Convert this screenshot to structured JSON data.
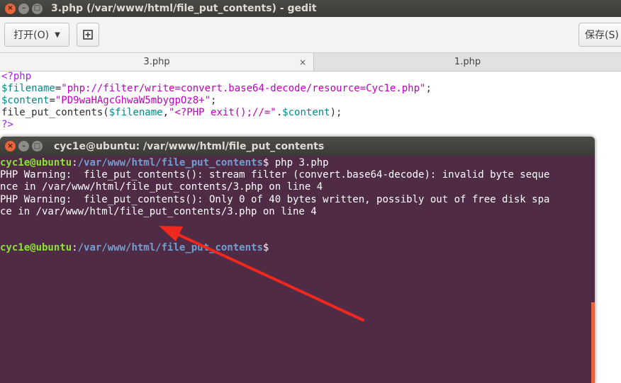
{
  "gedit": {
    "title": "3.php (/var/www/html/file_put_contents) - gedit",
    "toolbar": {
      "open_label": "打开(O)",
      "new_tab_icon": "new-document-icon",
      "save_label": "保存(S)"
    },
    "tabs": [
      {
        "label": "3.php",
        "active": true,
        "close": "×"
      },
      {
        "label": "1.php",
        "active": false
      }
    ],
    "code": {
      "line1": "<?php",
      "line2_var": "$filename",
      "line2_eq": "=",
      "line2_str": "\"php://filter/write=convert.base64-decode/resource=Cyc1e.php\"",
      "line2_end": ";",
      "line3_var": "$content",
      "line3_eq": "=",
      "line3_str": "\"PD9waHAgcGhwaW5mbygpOz8+\"",
      "line3_end": ";",
      "line4_fn": "file_put_contents(",
      "line4_var1": "$filename",
      "line4_comma": ",",
      "line4_str": "\"<?PHP exit();//=\"",
      "line4_dot": ".",
      "line4_var2": "$content",
      "line4_end": ");",
      "line5": "?>"
    }
  },
  "terminal": {
    "title": "cyc1e@ubuntu: /var/www/html/file_put_contents",
    "prompt_user": "cyc1e@ubuntu",
    "prompt_sep": ":",
    "prompt_path": "/var/www/html/file_put_contents",
    "prompt_end": "$",
    "command": " php 3.php",
    "output": [
      "PHP Warning:  file_put_contents(): stream filter (convert.base64-decode): invalid byte seque",
      "nce in /var/www/html/file_put_contents/3.php on line 4",
      "PHP Warning:  file_put_contents(): Only 0 of 40 bytes written, possibly out of free disk spa",
      "ce in /var/www/html/file_put_contents/3.php on line 4"
    ],
    "accent_color": "#e9643a",
    "background_color": "#4f2b46"
  },
  "annotation": {
    "arrow_color": "#f0281e"
  }
}
